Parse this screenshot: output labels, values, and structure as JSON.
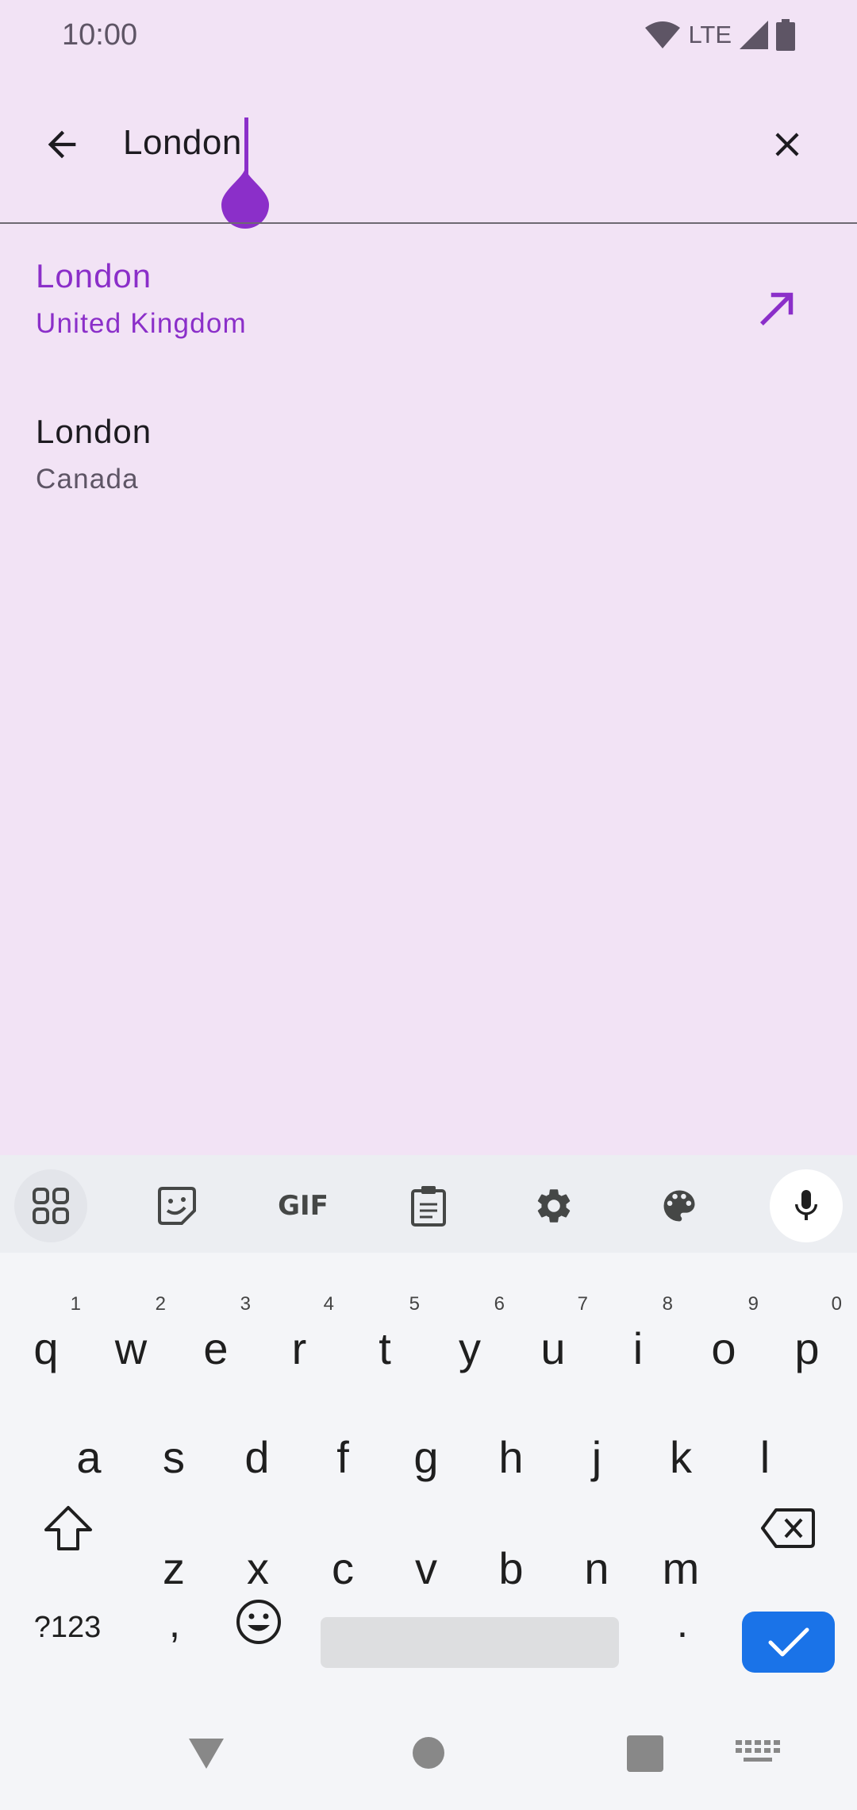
{
  "status_bar": {
    "time": "10:00",
    "network": "LTE"
  },
  "search": {
    "query": "London"
  },
  "results": [
    {
      "city": "London",
      "country": "United Kingdom"
    },
    {
      "city": "London",
      "country": "Canada"
    }
  ],
  "keyboard": {
    "toolbar": {
      "gif_label": "GIF"
    },
    "row1": [
      {
        "ch": "q",
        "num": "1"
      },
      {
        "ch": "w",
        "num": "2"
      },
      {
        "ch": "e",
        "num": "3"
      },
      {
        "ch": "r",
        "num": "4"
      },
      {
        "ch": "t",
        "num": "5"
      },
      {
        "ch": "y",
        "num": "6"
      },
      {
        "ch": "u",
        "num": "7"
      },
      {
        "ch": "i",
        "num": "8"
      },
      {
        "ch": "o",
        "num": "9"
      },
      {
        "ch": "p",
        "num": "0"
      }
    ],
    "row2": [
      "a",
      "s",
      "d",
      "f",
      "g",
      "h",
      "j",
      "k",
      "l"
    ],
    "row3": [
      "z",
      "x",
      "c",
      "v",
      "b",
      "n",
      "m"
    ],
    "symbols_label": "?123",
    "comma_label": ",",
    "period_label": "."
  },
  "colors": {
    "accent": "#8B2FC9",
    "background": "#F2E3F5",
    "enter_key": "#1A73E8"
  }
}
